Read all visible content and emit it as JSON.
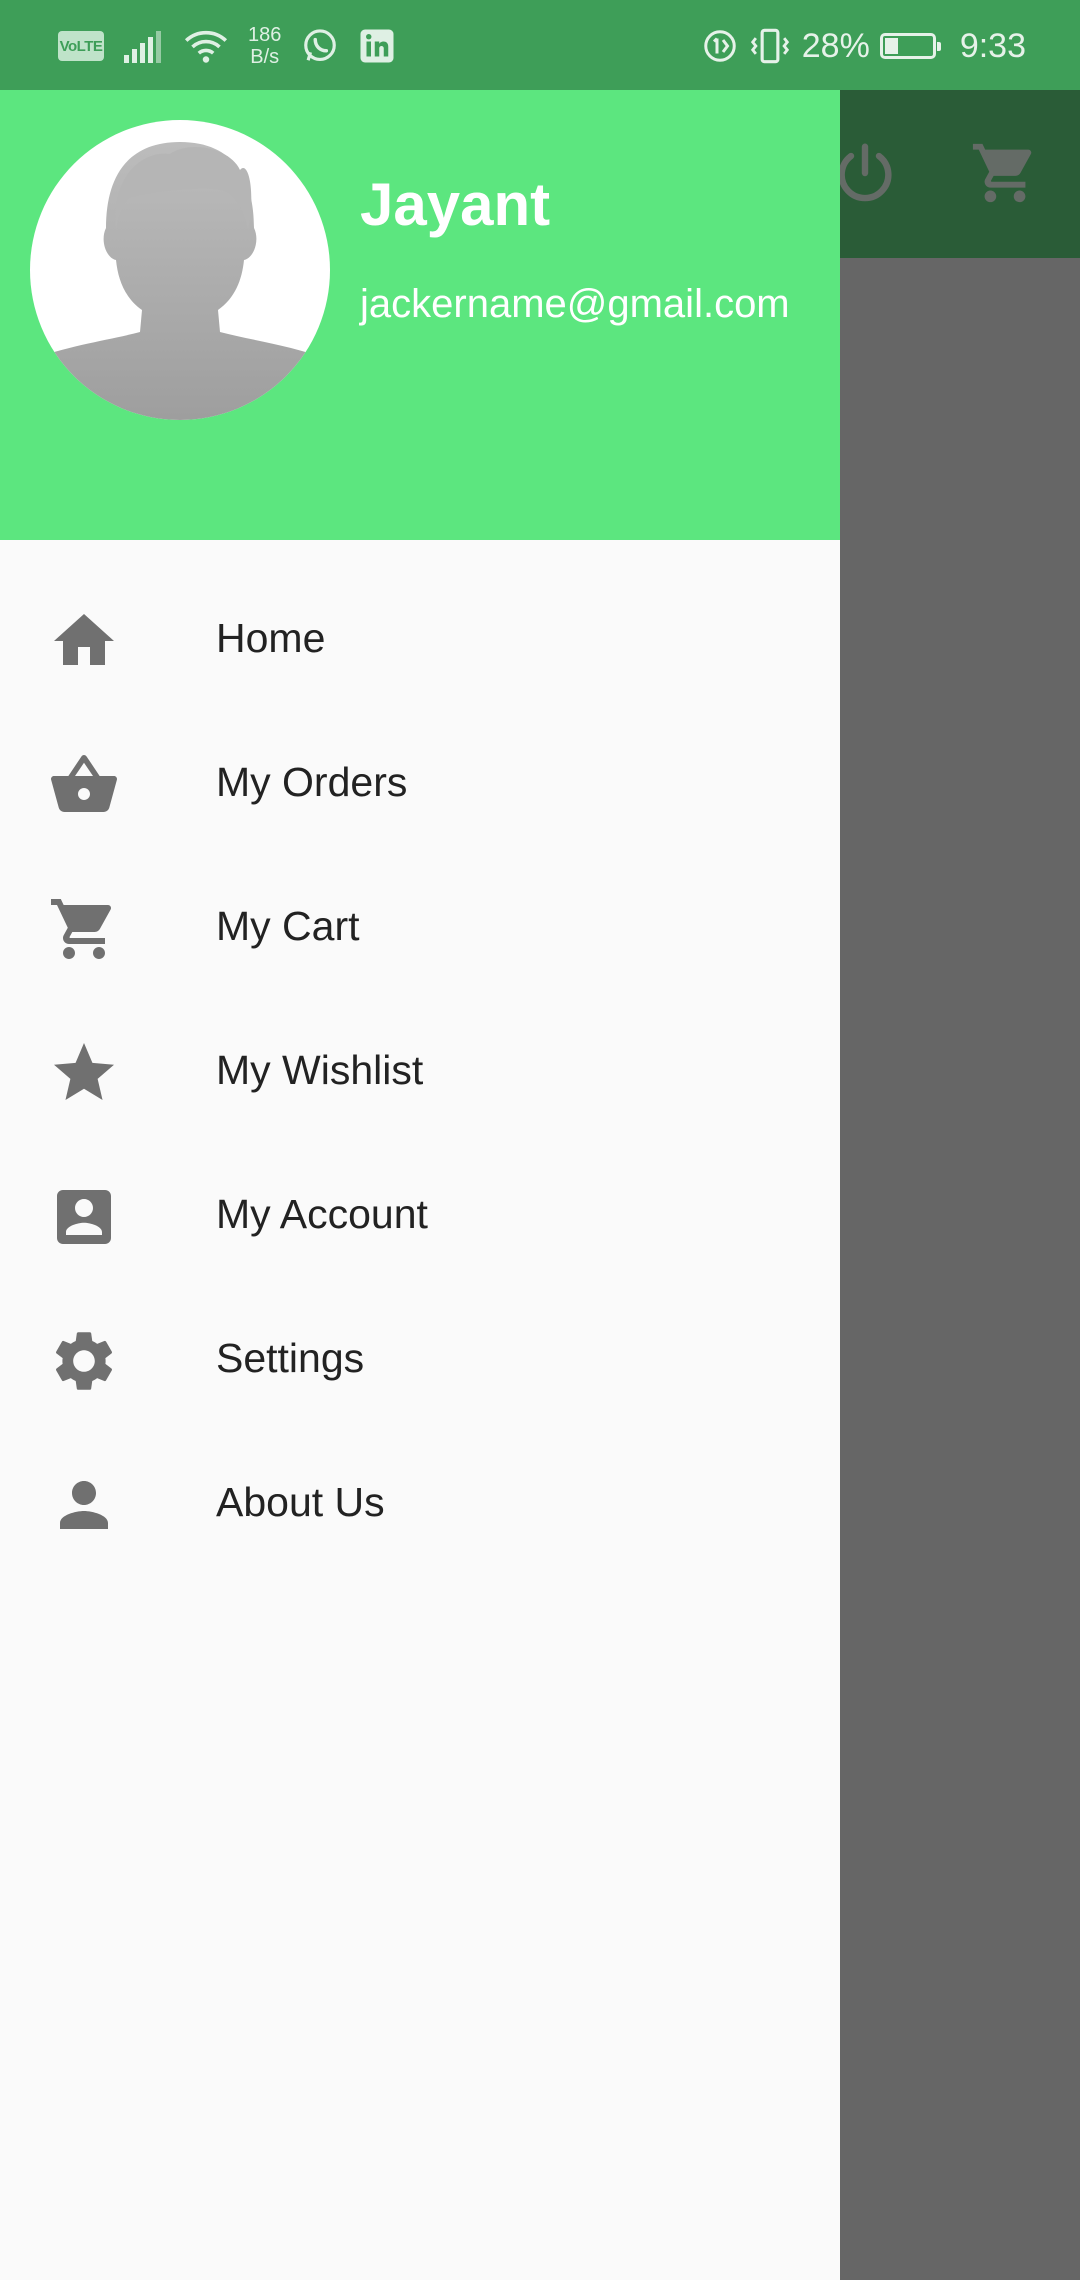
{
  "status_bar": {
    "volte": "VoLTE",
    "net_speed_value": "186",
    "net_speed_unit": "B/s",
    "battery_percent": "28%",
    "battery_level": 0.28,
    "time": "9:33",
    "icons": [
      "signal-icon",
      "wifi-icon",
      "whatsapp-icon",
      "linkedin-icon",
      "data-saver-icon",
      "vibrate-icon",
      "battery-icon"
    ]
  },
  "toolbar": {
    "icons": [
      "power-icon",
      "cart-icon"
    ],
    "color": "#2a5c37"
  },
  "drawer": {
    "header_color": "#5ce67f",
    "user": {
      "name": "Jayant",
      "email": "jackername@gmail.com"
    },
    "items": [
      {
        "label": "Home",
        "icon": "home-icon"
      },
      {
        "label": "My Orders",
        "icon": "basket-icon"
      },
      {
        "label": "My Cart",
        "icon": "cart-icon"
      },
      {
        "label": "My Wishlist",
        "icon": "star-icon"
      },
      {
        "label": "My Account",
        "icon": "account-box-icon"
      },
      {
        "label": "Settings",
        "icon": "gear-icon"
      },
      {
        "label": "About Us",
        "icon": "person-icon"
      }
    ]
  }
}
